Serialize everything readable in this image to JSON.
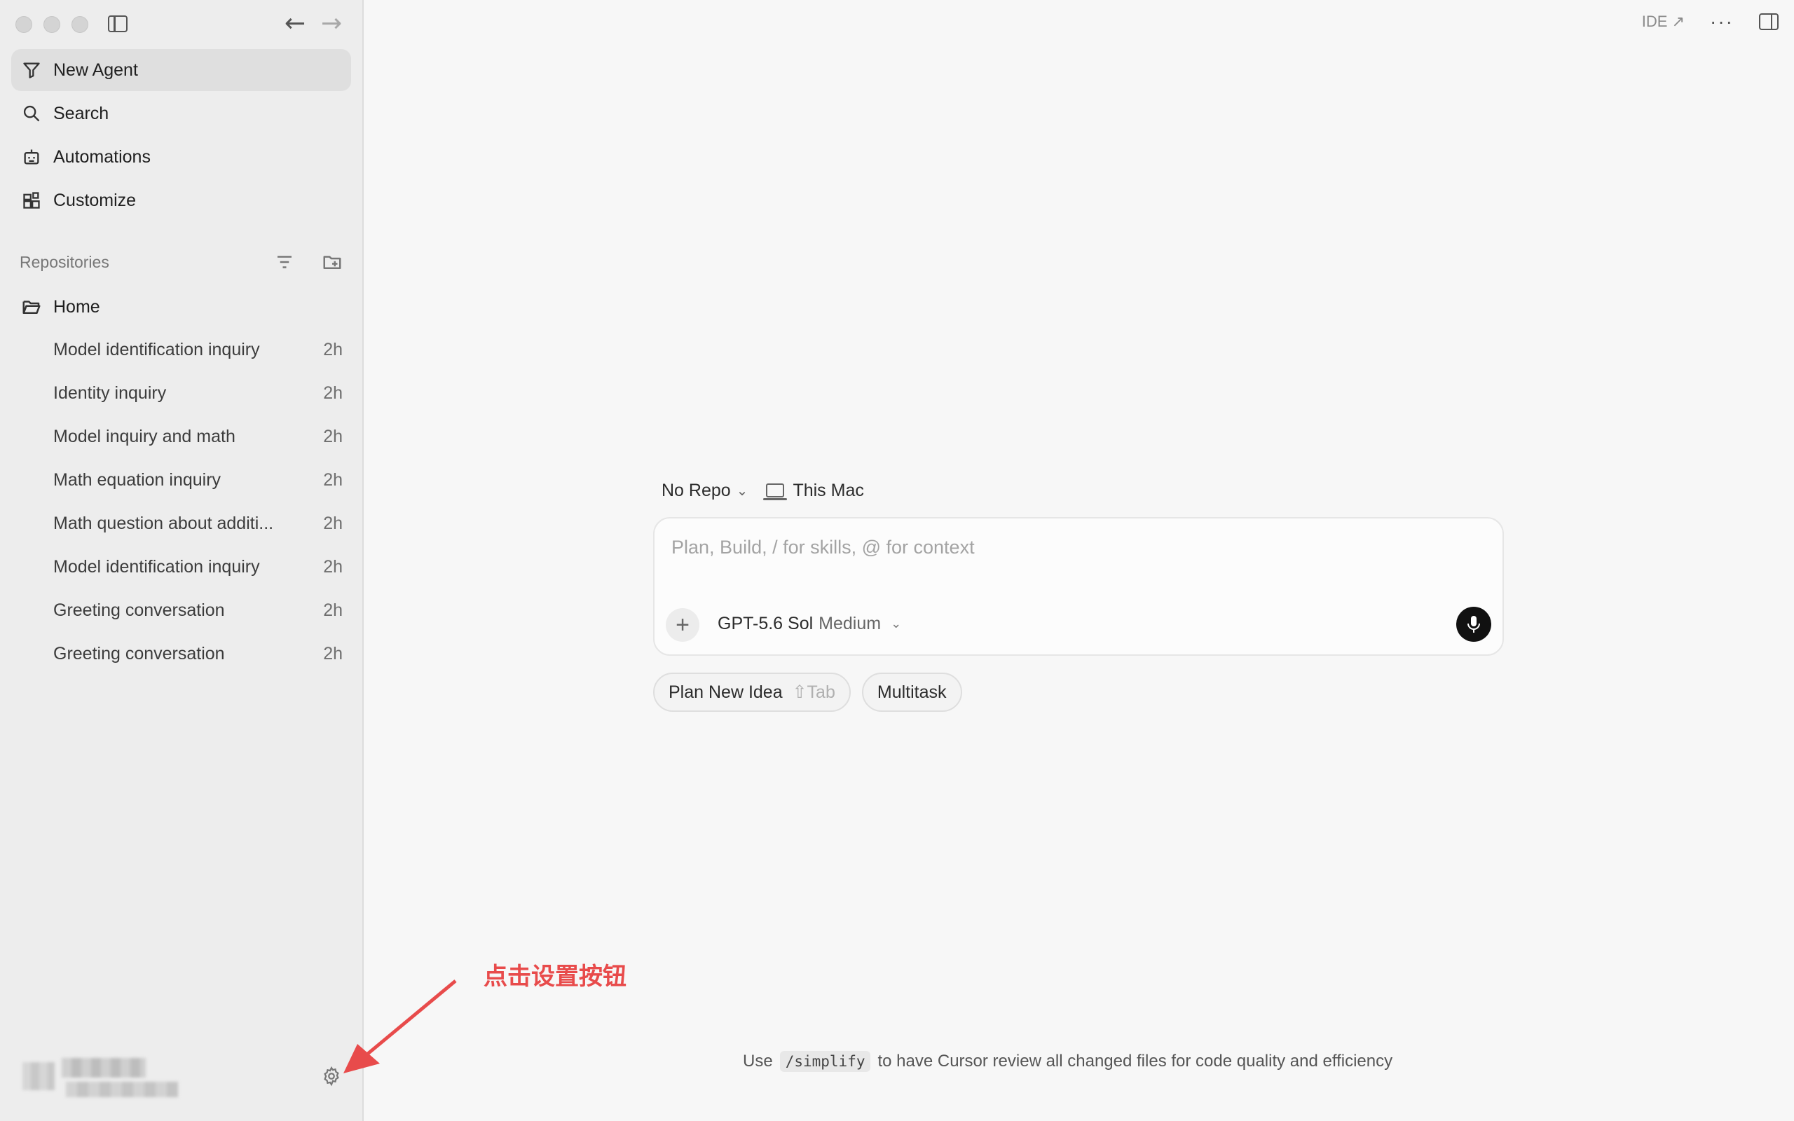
{
  "window": {
    "nav_back": "←",
    "nav_forward": "→"
  },
  "sidebar": {
    "menu": [
      {
        "label": "New Agent",
        "icon": "new-agent-icon",
        "active": true
      },
      {
        "label": "Search",
        "icon": "search-icon"
      },
      {
        "label": "Automations",
        "icon": "robot-icon"
      },
      {
        "label": "Customize",
        "icon": "customize-icon"
      }
    ],
    "repositories_label": "Repositories",
    "home_label": "Home",
    "threads": [
      {
        "title": "Model identification inquiry",
        "age": "2h"
      },
      {
        "title": "Identity inquiry",
        "age": "2h"
      },
      {
        "title": "Model inquiry and math",
        "age": "2h"
      },
      {
        "title": "Math equation inquiry",
        "age": "2h"
      },
      {
        "title": "Math question about additi...",
        "age": "2h"
      },
      {
        "title": "Model identification inquiry",
        "age": "2h"
      },
      {
        "title": "Greeting conversation",
        "age": "2h"
      },
      {
        "title": "Greeting conversation",
        "age": "2h"
      }
    ]
  },
  "topbar": {
    "ide_label": "IDE ↗",
    "more": "···"
  },
  "composer": {
    "repo_label": "No Repo",
    "machine_label": "This Mac",
    "placeholder": "Plan, Build, / for skills, @ for context",
    "add": "+",
    "model_name": "GPT-5.6 Sol",
    "model_effort": "Medium",
    "chevron": "⌄",
    "chips": [
      {
        "label": "Plan New Idea",
        "shortcut": "⇧Tab"
      },
      {
        "label": "Multitask"
      }
    ]
  },
  "tip": {
    "prefix": "Use",
    "command": "/simplify",
    "suffix": "to have Cursor review all changed files for code quality and efficiency"
  },
  "annotation": {
    "text": "点击设置按钮",
    "color": "#e84b4b"
  }
}
